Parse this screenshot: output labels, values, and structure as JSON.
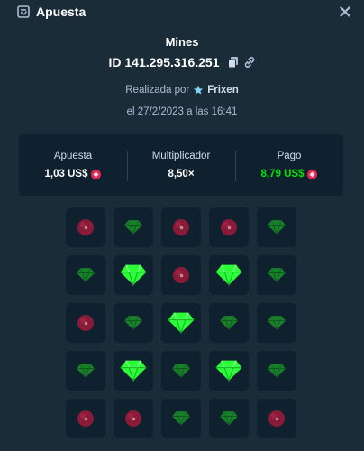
{
  "header": {
    "title": "Apuesta",
    "icon": "bet-slip-icon",
    "close_icon": "close-icon"
  },
  "bet": {
    "game": "Mines",
    "id": "ID 141.295.316.251",
    "placed_by_label": "Realizada por",
    "user": "Frixen",
    "date": "el 27/2/2023 a las 16:41"
  },
  "stats": {
    "bet_label": "Apuesta",
    "bet_value": "1,03 US$",
    "multiplier_label": "Multiplicador",
    "multiplier_value": "8,50×",
    "payout_label": "Pago",
    "payout_value": "8,79 US$"
  },
  "colors": {
    "background": "#1a2c38",
    "panel": "#0f212e",
    "payout": "#00e701",
    "gem_revealed": "#2cff3a",
    "gem_dim": "#1a8f2a",
    "mine": "#8a1b38",
    "coin": "#e02851"
  },
  "grid": {
    "rows": [
      [
        "mine",
        "gem",
        "mine",
        "mine",
        "gem"
      ],
      [
        "gem",
        "gem-revealed",
        "mine",
        "gem-revealed",
        "gem"
      ],
      [
        "mine",
        "gem",
        "gem-revealed",
        "gem",
        "gem"
      ],
      [
        "gem",
        "gem-revealed",
        "gem",
        "gem-revealed",
        "gem"
      ],
      [
        "mine",
        "mine",
        "gem",
        "gem",
        "mine"
      ]
    ]
  }
}
